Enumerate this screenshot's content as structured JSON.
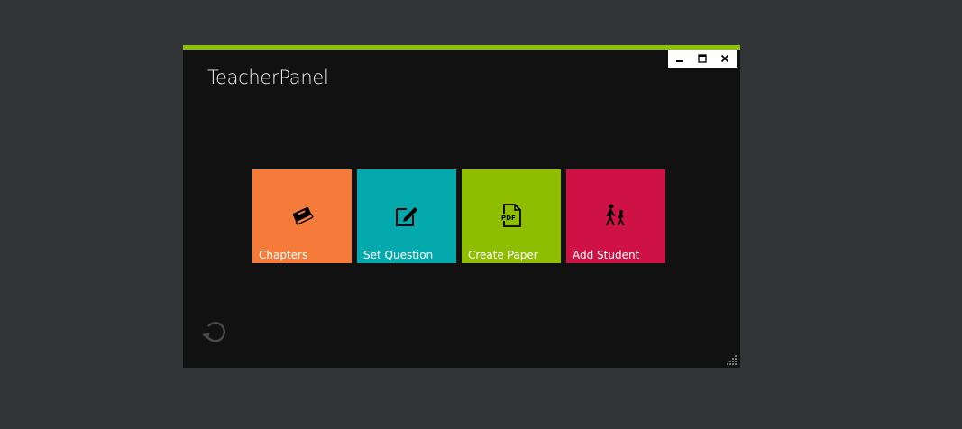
{
  "window": {
    "title": "TeacherPanel",
    "accent_color": "#8cc10a",
    "controls": {
      "minimize": "_",
      "maximize": "☐",
      "close": "✕"
    }
  },
  "tiles": [
    {
      "label": "Chapters",
      "icon": "book-icon",
      "color": "#f47b3a"
    },
    {
      "label": "Set Question",
      "icon": "edit-icon",
      "color": "#04a9ad"
    },
    {
      "label": "Create Paper",
      "icon": "pdf-icon",
      "color": "#8fbe00"
    },
    {
      "label": "Add Student",
      "icon": "walking-people-icon",
      "color": "#cf1245"
    }
  ],
  "footer": {
    "refresh_icon": "refresh-icon",
    "resize_icon": "resize-grip-icon"
  }
}
